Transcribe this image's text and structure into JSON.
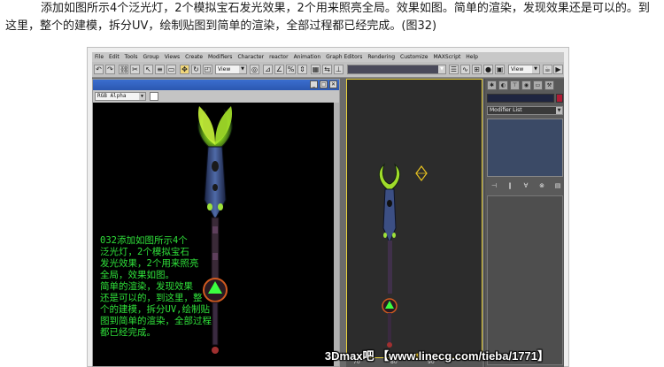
{
  "article": {
    "text": "添加如图所示4个泛光灯，2个模拟宝石发光效果，2个用来照亮全局。效果如图。简单的渲染，发现效果还是可以的。到这里，整个的建模，拆分UV，绘制贴图到简单的渲染，全部过程都已经完成。(图32)"
  },
  "app": {
    "menu": [
      "File",
      "Edit",
      "Tools",
      "Group",
      "Views",
      "Create",
      "Modifiers",
      "Character",
      "reactor",
      "Animation",
      "Graph Editors",
      "Rendering",
      "Customize",
      "MAXScript",
      "Help"
    ],
    "toolbar": {
      "view_combo": "View",
      "view_combo_right": "View"
    },
    "render_window": {
      "channel": "RGB Alpha",
      "overlay_text": "032添加如图所示4个\n泛光灯，2个模拟宝石\n发光效果，2个用来照亮\n全局，效果如图。\n简单的渲染，发现效果\n还是可以的，到这里，整\n个的建模，拆分UV,绘制贴\n图到简单的渲染，全部过程\n都已经完成。"
    },
    "viewport_ruler": [
      "70",
      "80",
      "90"
    ],
    "command_panel": {
      "modifier_list": "Modifier List"
    }
  },
  "watermark": "3Dmax吧 【www.linecg.com/tieba/1771】",
  "colors": {
    "overlay_text": "#2fe03a",
    "render_title": "#2b57b0",
    "object_color_swatch": "#b01c36"
  }
}
